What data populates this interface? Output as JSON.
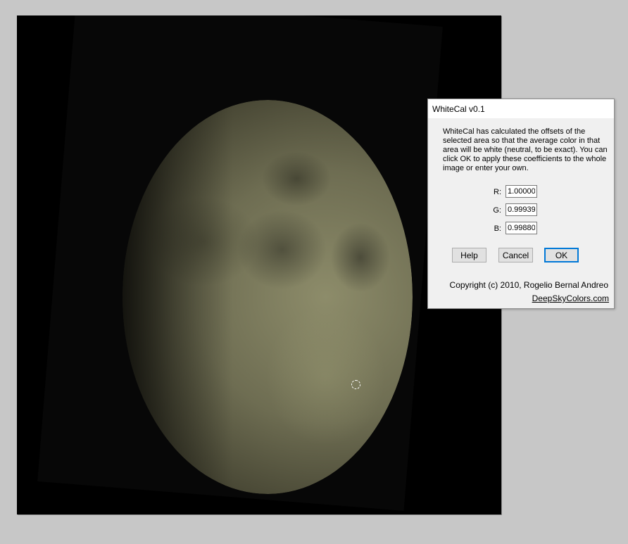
{
  "dialog": {
    "title": "WhiteCal v0.1",
    "message": "WhiteCal has calculated the offsets of the selected area so that the average color in that area will be white (neutral, to be exact). You can click OK to apply these coefficients to the whole image or enter your own.",
    "fields": [
      {
        "label": "R:",
        "value": "1.00000"
      },
      {
        "label": "G:",
        "value": "0.99939"
      },
      {
        "label": "B:",
        "value": "0.99880"
      }
    ],
    "buttons": {
      "help": "Help",
      "cancel": "Cancel",
      "ok": "OK"
    },
    "copyright": "Copyright (c) 2010, Rogelio Bernal Andreo",
    "link": "DeepSkyColors.com"
  },
  "image": {
    "subject": "moon-photo",
    "selection_marker": "circular-selection-marker"
  }
}
